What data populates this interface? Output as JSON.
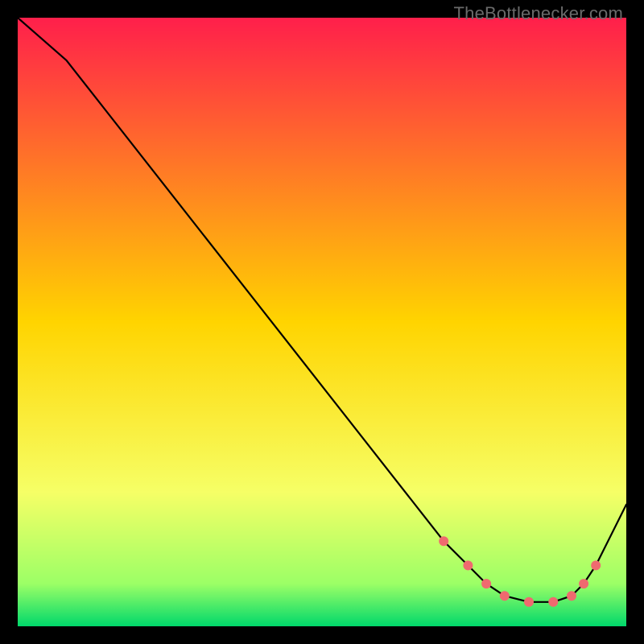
{
  "watermark": "TheBottlenecker.com",
  "chart_data": {
    "type": "line",
    "title": "",
    "xlabel": "",
    "ylabel": "",
    "xlim": [
      0,
      100
    ],
    "ylim": [
      0,
      100
    ],
    "gradient_stops": [
      {
        "offset": 0.0,
        "color": "#ff1f4b"
      },
      {
        "offset": 0.5,
        "color": "#ffd400"
      },
      {
        "offset": 0.78,
        "color": "#f6ff66"
      },
      {
        "offset": 0.93,
        "color": "#9cff66"
      },
      {
        "offset": 1.0,
        "color": "#00d86b"
      }
    ],
    "series": [
      {
        "name": "curve",
        "x": [
          0,
          8,
          70,
          74,
          77,
          80,
          84,
          88,
          91,
          93,
          95,
          100
        ],
        "y": [
          100,
          93,
          14,
          10,
          7,
          5,
          4,
          4,
          5,
          7,
          10,
          20
        ]
      }
    ],
    "markers": {
      "name": "highlight-points",
      "color": "#ef6a6f",
      "radius": 6,
      "x": [
        70,
        74,
        77,
        80,
        84,
        88,
        91,
        93,
        95
      ],
      "y": [
        14,
        10,
        7,
        5,
        4,
        4,
        5,
        7,
        10
      ]
    }
  }
}
